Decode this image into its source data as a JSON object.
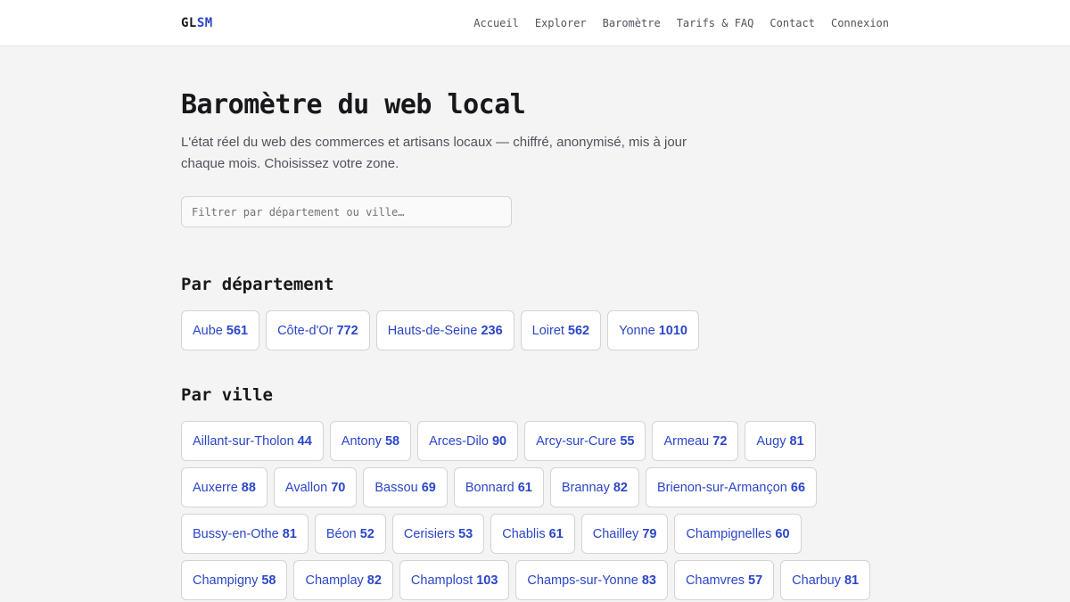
{
  "header": {
    "logo_part1": "GL",
    "logo_part2": "SM",
    "nav": [
      "Accueil",
      "Explorer",
      "Baromètre",
      "Tarifs & FAQ",
      "Contact",
      "Connexion"
    ]
  },
  "main": {
    "title": "Baromètre du web local",
    "lead": "L'état réel du web des commerces et artisans locaux — chiffré, anonymisé, mis à jour chaque mois. Choisissez votre zone.",
    "filter_placeholder": "Filtrer par département ou ville…",
    "departments_title": "Par département",
    "departments": [
      {
        "name": "Aube",
        "count": "561"
      },
      {
        "name": "Côte-d'Or",
        "count": "772"
      },
      {
        "name": "Hauts-de-Seine",
        "count": "236"
      },
      {
        "name": "Loiret",
        "count": "562"
      },
      {
        "name": "Yonne",
        "count": "1010"
      }
    ],
    "cities_title": "Par ville",
    "cities": [
      {
        "name": "Aillant-sur-Tholon",
        "count": "44"
      },
      {
        "name": "Antony",
        "count": "58"
      },
      {
        "name": "Arces-Dilo",
        "count": "90"
      },
      {
        "name": "Arcy-sur-Cure",
        "count": "55"
      },
      {
        "name": "Armeau",
        "count": "72"
      },
      {
        "name": "Augy",
        "count": "81"
      },
      {
        "name": "Auxerre",
        "count": "88"
      },
      {
        "name": "Avallon",
        "count": "70"
      },
      {
        "name": "Bassou",
        "count": "69"
      },
      {
        "name": "Bonnard",
        "count": "61"
      },
      {
        "name": "Brannay",
        "count": "82"
      },
      {
        "name": "Brienon-sur-Armançon",
        "count": "66"
      },
      {
        "name": "Bussy-en-Othe",
        "count": "81"
      },
      {
        "name": "Béon",
        "count": "52"
      },
      {
        "name": "Cerisiers",
        "count": "53"
      },
      {
        "name": "Chablis",
        "count": "61"
      },
      {
        "name": "Chailley",
        "count": "79"
      },
      {
        "name": "Champignelles",
        "count": "60"
      },
      {
        "name": "Champigny",
        "count": "58"
      },
      {
        "name": "Champlay",
        "count": "82"
      },
      {
        "name": "Champlost",
        "count": "103"
      },
      {
        "name": "Champs-sur-Yonne",
        "count": "83"
      },
      {
        "name": "Chamvres",
        "count": "57"
      },
      {
        "name": "Charbuy",
        "count": "81"
      }
    ]
  }
}
